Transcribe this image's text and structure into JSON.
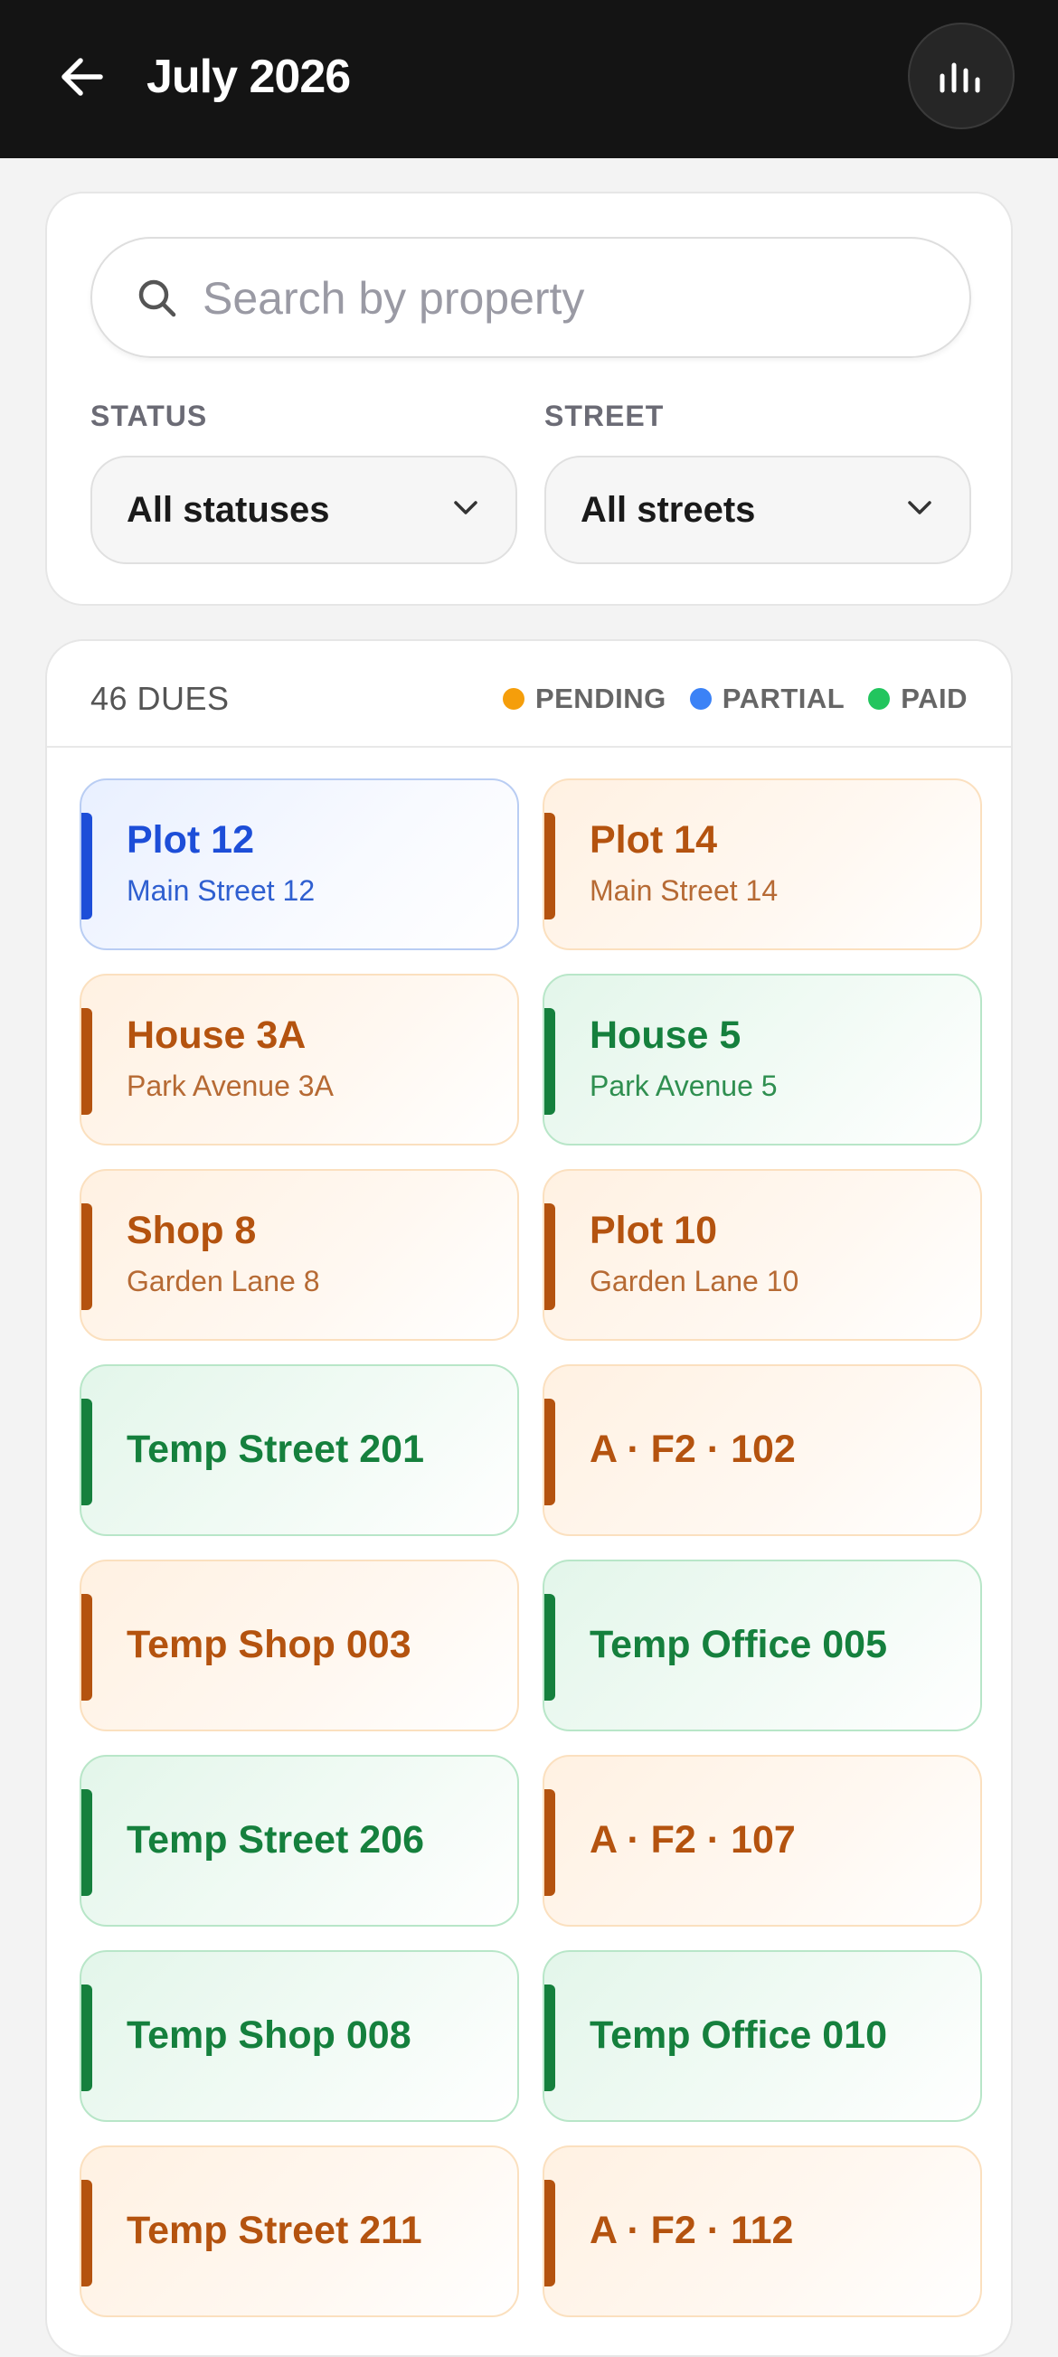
{
  "header": {
    "title": "July 2026"
  },
  "search": {
    "placeholder": "Search by property"
  },
  "filters": {
    "status": {
      "label": "STATUS",
      "value": "All statuses"
    },
    "street": {
      "label": "STREET",
      "value": "All streets"
    }
  },
  "list": {
    "count_label": "46 DUES",
    "legend": [
      {
        "label": "PENDING",
        "color": "#f59e0b"
      },
      {
        "label": "PARTIAL",
        "color": "#3b82f6"
      },
      {
        "label": "PAID",
        "color": "#22c55e"
      }
    ],
    "items": [
      {
        "name": "Plot 12",
        "address": "Main Street 12",
        "status": "partial"
      },
      {
        "name": "Plot 14",
        "address": "Main Street 14",
        "status": "pending"
      },
      {
        "name": "House 3A",
        "address": "Park Avenue 3A",
        "status": "pending"
      },
      {
        "name": "House 5",
        "address": "Park Avenue 5",
        "status": "paid"
      },
      {
        "name": "Shop 8",
        "address": "Garden Lane 8",
        "status": "pending"
      },
      {
        "name": "Plot 10",
        "address": "Garden Lane 10",
        "status": "pending"
      },
      {
        "name": "Temp Street 201",
        "address": "",
        "status": "paid"
      },
      {
        "name": "A · F2 · 102",
        "address": "",
        "status": "pending"
      },
      {
        "name": "Temp Shop 003",
        "address": "",
        "status": "pending"
      },
      {
        "name": "Temp Office 005",
        "address": "",
        "status": "paid"
      },
      {
        "name": "Temp Street 206",
        "address": "",
        "status": "paid"
      },
      {
        "name": "A · F2 · 107",
        "address": "",
        "status": "pending"
      },
      {
        "name": "Temp Shop 008",
        "address": "",
        "status": "paid"
      },
      {
        "name": "Temp Office 010",
        "address": "",
        "status": "paid"
      },
      {
        "name": "Temp Street 211",
        "address": "",
        "status": "pending"
      },
      {
        "name": "A · F2 · 112",
        "address": "",
        "status": "pending"
      }
    ]
  },
  "icons": {
    "back": "arrow-left-icon",
    "stats": "bar-chart-icon",
    "search": "search-icon",
    "dropdown": "chevron-down-icon"
  }
}
